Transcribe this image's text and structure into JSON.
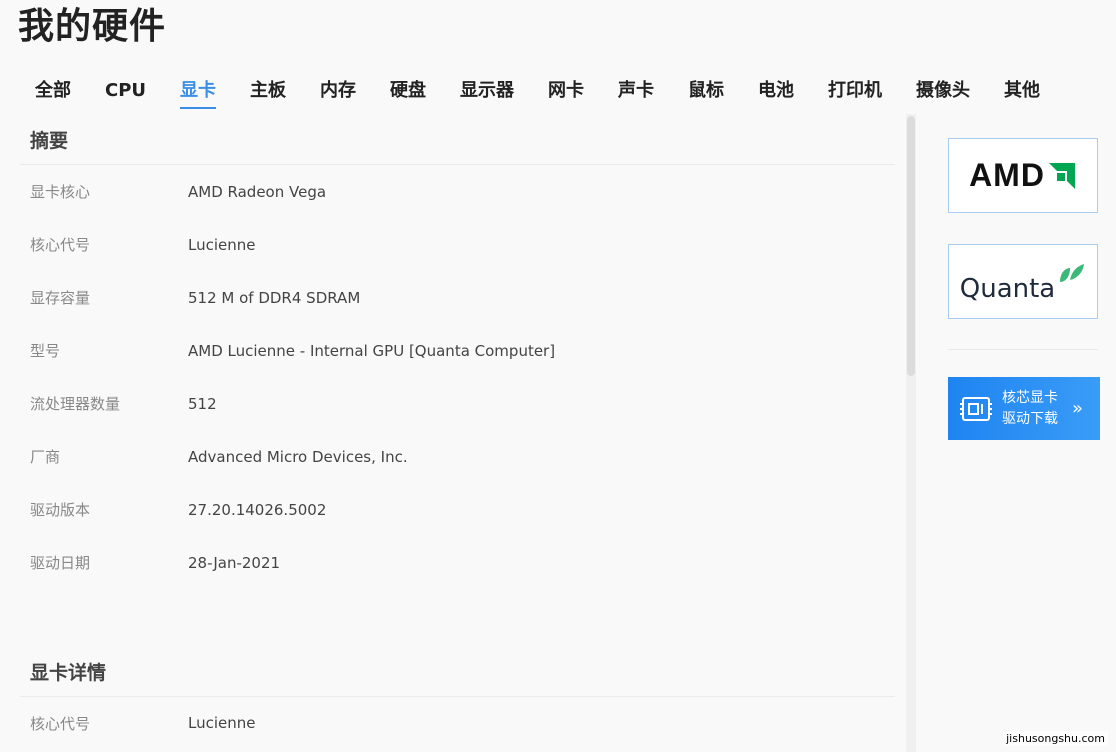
{
  "page_title": "我的硬件",
  "tabs": [
    {
      "label": "全部"
    },
    {
      "label": "CPU"
    },
    {
      "label": "显卡"
    },
    {
      "label": "主板"
    },
    {
      "label": "内存"
    },
    {
      "label": "硬盘"
    },
    {
      "label": "显示器"
    },
    {
      "label": "网卡"
    },
    {
      "label": "声卡"
    },
    {
      "label": "鼠标"
    },
    {
      "label": "电池"
    },
    {
      "label": "打印机"
    },
    {
      "label": "摄像头"
    },
    {
      "label": "其他"
    }
  ],
  "active_tab": "显卡",
  "summary": {
    "title": "摘要",
    "rows": [
      {
        "label": "显卡核心",
        "value": "AMD Radeon Vega"
      },
      {
        "label": "核心代号",
        "value": "Lucienne"
      },
      {
        "label": "显存容量",
        "value": "512 M of DDR4 SDRAM"
      },
      {
        "label": "型号",
        "value": "AMD Lucienne - Internal GPU [Quanta Computer]"
      },
      {
        "label": "流处理器数量",
        "value": "512"
      },
      {
        "label": "厂商",
        "value": "Advanced Micro Devices, Inc."
      },
      {
        "label": "驱动版本",
        "value": "27.20.14026.5002"
      },
      {
        "label": "驱动日期",
        "value": "28-Jan-2021"
      }
    ]
  },
  "details": {
    "title": "显卡详情",
    "rows": [
      {
        "label": "核心代号",
        "value": "Lucienne"
      }
    ]
  },
  "sidebar": {
    "brand1": "AMD",
    "brand2": "Quanta",
    "promo_line1": "核芯显卡",
    "promo_line2": "驱动下载",
    "promo_arrow": "»"
  },
  "watermark": "jishusongshu.com",
  "colors": {
    "accent": "#3a8ee6",
    "amd_green": "#00a651",
    "quanta_green": "#3cb878",
    "promo_blue": "#1e84f0"
  }
}
